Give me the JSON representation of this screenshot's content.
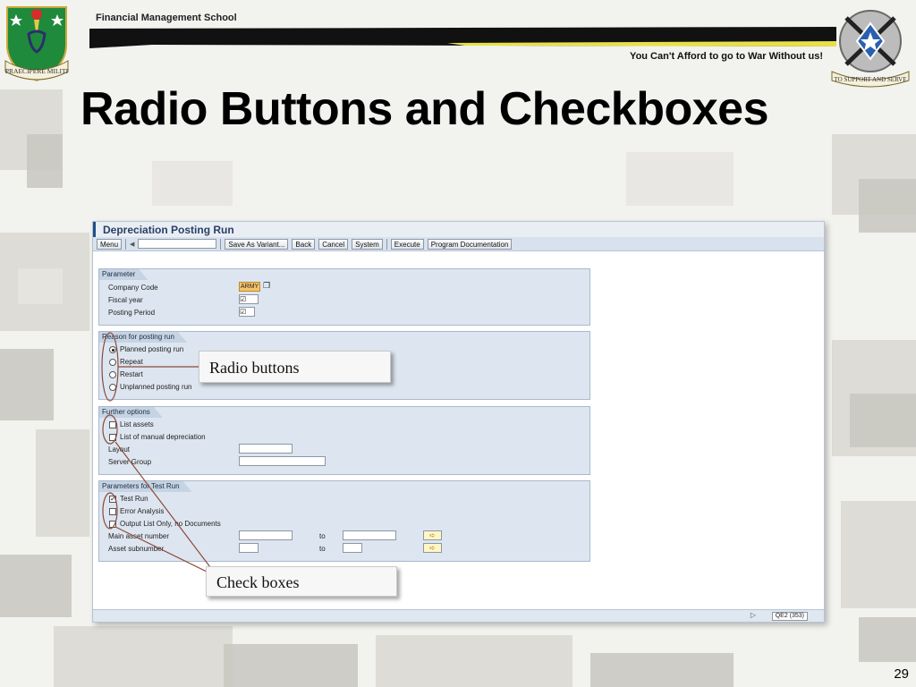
{
  "header": {
    "org": "Financial Management School",
    "motto": "You Can't Afford to go to War Without us!",
    "title": "Radio Buttons and Checkboxes",
    "left_logo_text": "PRAECIPERE MILITI",
    "right_logo_text": "TO SUPPORT AND SERVE"
  },
  "sap": {
    "window_title": "Depreciation Posting Run",
    "toolbar": {
      "menu": "Menu",
      "save_variant": "Save As Variant...",
      "back": "Back",
      "cancel": "Cancel",
      "system": "System",
      "execute": "Execute",
      "program_doc": "Program Documentation"
    },
    "parameter": {
      "title": "Parameter",
      "company_code_label": "Company Code",
      "company_code_value": "ARMY",
      "fiscal_year_label": "Fiscal year",
      "posting_period_label": "Posting Period"
    },
    "reason": {
      "title": "Reason for posting run",
      "options": [
        "Planned posting run",
        "Repeat",
        "Restart",
        "Unplanned posting run"
      ],
      "selected": "Planned posting run"
    },
    "further": {
      "title": "Further options",
      "list_assets": "List assets",
      "list_manual": "List of manual depreciation",
      "layout": "Layout",
      "server_group": "Server Group"
    },
    "test_run": {
      "title": "Parameters for Test Run",
      "test_run": "Test Run",
      "error_analysis": "Error Analysis",
      "output_list": "Output List Only, no Documents",
      "main_asset": "Main asset number",
      "asset_sub": "Asset subnumber",
      "to": "to"
    },
    "status": "QE2 (353)"
  },
  "callouts": {
    "radio": "Radio buttons",
    "check": "Check boxes"
  },
  "page_number": "29",
  "colors": {
    "sap_blue": "#1f4e8c",
    "group_bg": "#dde6f0",
    "required_field": "#f6c36a",
    "band": "#111111",
    "band_highlight": "#e8e04a"
  }
}
